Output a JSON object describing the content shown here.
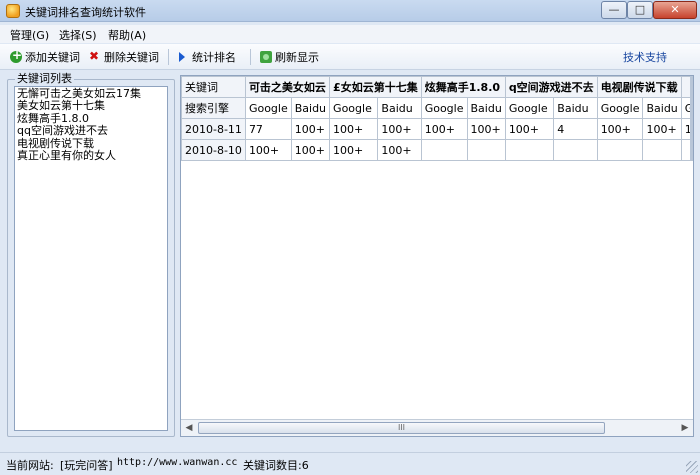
{
  "window": {
    "title": "关键词排名查询统计软件",
    "controls": {
      "minimize": "—",
      "maximize": "□",
      "close": "✕"
    }
  },
  "menu": {
    "items": [
      "管理(G)",
      "选择(S)",
      "帮助(A)"
    ]
  },
  "toolbar": {
    "add_label": "添加关键词",
    "delete_label": "删除关键词",
    "stats_label": "统计排名",
    "refresh_label": "刷新显示",
    "support_label": "技术支持"
  },
  "keyword_panel": {
    "title": "关键词列表",
    "items": [
      "无懈可击之美女如云17集",
      "美女如云第十七集",
      "炫舞高手1.8.0",
      "qq空间游戏进不去",
      "电视剧传说下载",
      "真正心里有你的女人"
    ]
  },
  "grid": {
    "header_row1": [
      "关键词",
      "可击之美女如云",
      "£女如云第十七集",
      "炫舞高手1.8.0",
      "q空间游戏进不去",
      "电视剧传说下载",
      ""
    ],
    "header_row2": [
      "搜索引擎",
      "Google",
      "Baidu",
      "Google",
      "Baidu",
      "Google",
      "Baidu",
      "Google",
      "Baidu",
      "Google",
      "Baidu",
      "G"
    ],
    "rows": [
      [
        "2010-8-11",
        "77",
        "100+",
        "100+",
        "100+",
        "100+",
        "100+",
        "100+",
        "4",
        "100+",
        "100+",
        "1"
      ],
      [
        "2010-8-10",
        "100+",
        "100+",
        "100+",
        "100+",
        "",
        "",
        "",
        "",
        "",
        "",
        ""
      ]
    ],
    "scroll_thumb": "III"
  },
  "status": {
    "label": "当前网站:",
    "site": "[玩完问答]",
    "url": "http://www.wanwan.cc",
    "count": "关键词数目:6"
  }
}
